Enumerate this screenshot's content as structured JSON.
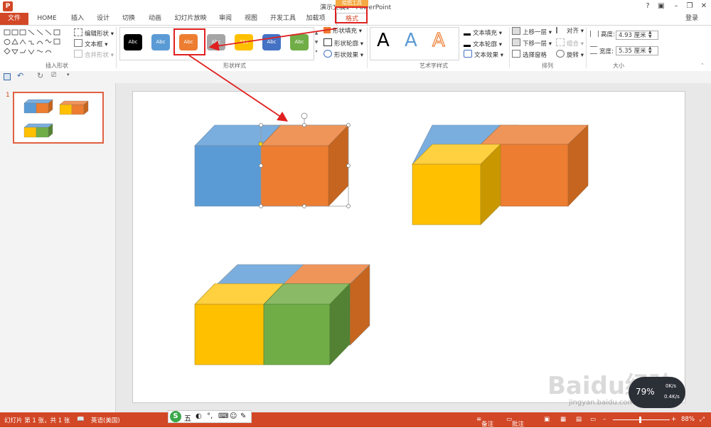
{
  "window": {
    "title": "演示文稿1 - PowerPoint",
    "context_tag": "绘图工具",
    "controls": [
      "?",
      "▣",
      "–",
      "❐",
      "✕"
    ],
    "login": "登录"
  },
  "tabs": {
    "file": "文件",
    "items": [
      "HOME",
      "插入",
      "设计",
      "切换",
      "动画",
      "幻灯片放映",
      "审阅",
      "视图",
      "开发工具",
      "加载项"
    ],
    "active": "格式"
  },
  "ribbon": {
    "insert_shapes": {
      "label": "插入形状",
      "edit_shape": "编辑形状",
      "text_box": "文本框",
      "merge_shapes": "合并形状"
    },
    "shape_styles": {
      "label": "形状样式",
      "swatch_text": "Abc",
      "swatches": [
        {
          "color": "#000000"
        },
        {
          "color": "#5b9bd5"
        },
        {
          "color": "#ed7d31"
        },
        {
          "color": "#a5a5a5"
        },
        {
          "color": "#ffc000"
        },
        {
          "color": "#4472c4"
        },
        {
          "color": "#70ad47"
        }
      ],
      "selected_index": 2,
      "fill": "形状填充",
      "outline": "形状轮廓",
      "effects": "形状效果"
    },
    "wordart": {
      "label": "艺术字样式",
      "letter": "A",
      "text_fill": "文本填充",
      "text_outline": "文本轮廓",
      "text_effects": "文本效果"
    },
    "arrange": {
      "label": "排列",
      "bring_forward": "上移一层",
      "send_backward": "下移一层",
      "selection_pane": "选择窗格",
      "align": "对齐",
      "group": "组合",
      "rotate": "旋转"
    },
    "size": {
      "label": "大小",
      "height_label": "高度:",
      "height_value": "4.93 厘米",
      "width_label": "宽度:",
      "width_value": "5.35 厘米"
    }
  },
  "thumbnail": {
    "number": "1"
  },
  "statusbar": {
    "slide_info": "幻灯片 第 1 张，共 1 张",
    "language": "英语(美国)",
    "notes": "备注",
    "comments": "批注",
    "zoom": "88%"
  },
  "ime": {
    "label": "五"
  },
  "net_widget": {
    "percent": "79%",
    "up": "0K/s",
    "down": "0.4K/s"
  },
  "watermark": {
    "text": "Baidu经验",
    "url": "jingyan.baidu.com"
  },
  "colors": {
    "accent": "#d24726",
    "annotation_red": "#e02020",
    "blue": "#5b9bd5",
    "orange": "#ed7d31",
    "yellow": "#ffc000",
    "green": "#70ad47"
  }
}
